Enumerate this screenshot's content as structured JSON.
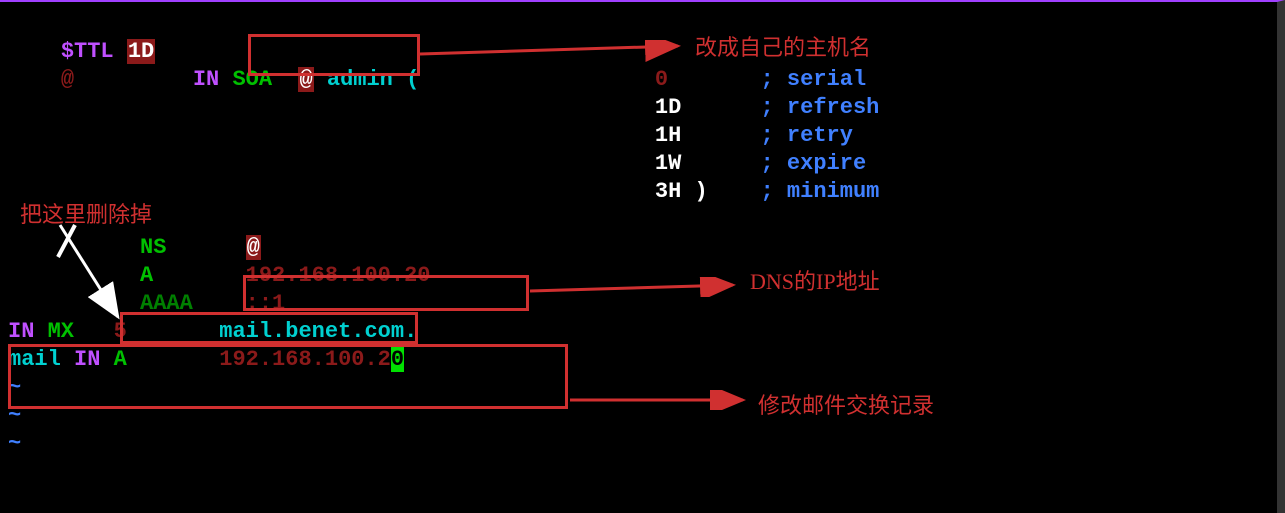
{
  "annotations": {
    "hostname": "改成自己的主机名",
    "delete": "把这里删除掉",
    "dns_ip": "DNS的IP地址",
    "mail_record": "修改邮件交换记录"
  },
  "vim": {
    "tilde": "~"
  },
  "ttl": {
    "directive": "$TTL ",
    "value": "1D"
  },
  "soa": {
    "origin": "@",
    "in": "IN",
    "soa": "SOA",
    "at": "@",
    "admin": " admin (",
    "params": {
      "serial": {
        "val": "0 ",
        "comment": "; serial"
      },
      "refresh": {
        "val": "1D",
        "comment": "; refresh"
      },
      "retry": {
        "val": "1H",
        "comment": "; retry"
      },
      "expire": {
        "val": "1W",
        "comment": "; expire"
      },
      "minimum": {
        "val": "3H )",
        "comment": "; minimum"
      }
    }
  },
  "ns": {
    "type": "NS",
    "at": "@"
  },
  "a": {
    "type": "A",
    "ip": "192.168.100.20"
  },
  "aaaa": {
    "type": "AAAA",
    "ip": "::1"
  },
  "mx": {
    "in": "IN",
    "type": "MX",
    "pref": "5",
    "host": "mail.benet.com."
  },
  "mail": {
    "name": "mail",
    "in": "IN",
    "type": "A",
    "ip_prefix": "192.168.100.2",
    "ip_cursor": "0"
  }
}
